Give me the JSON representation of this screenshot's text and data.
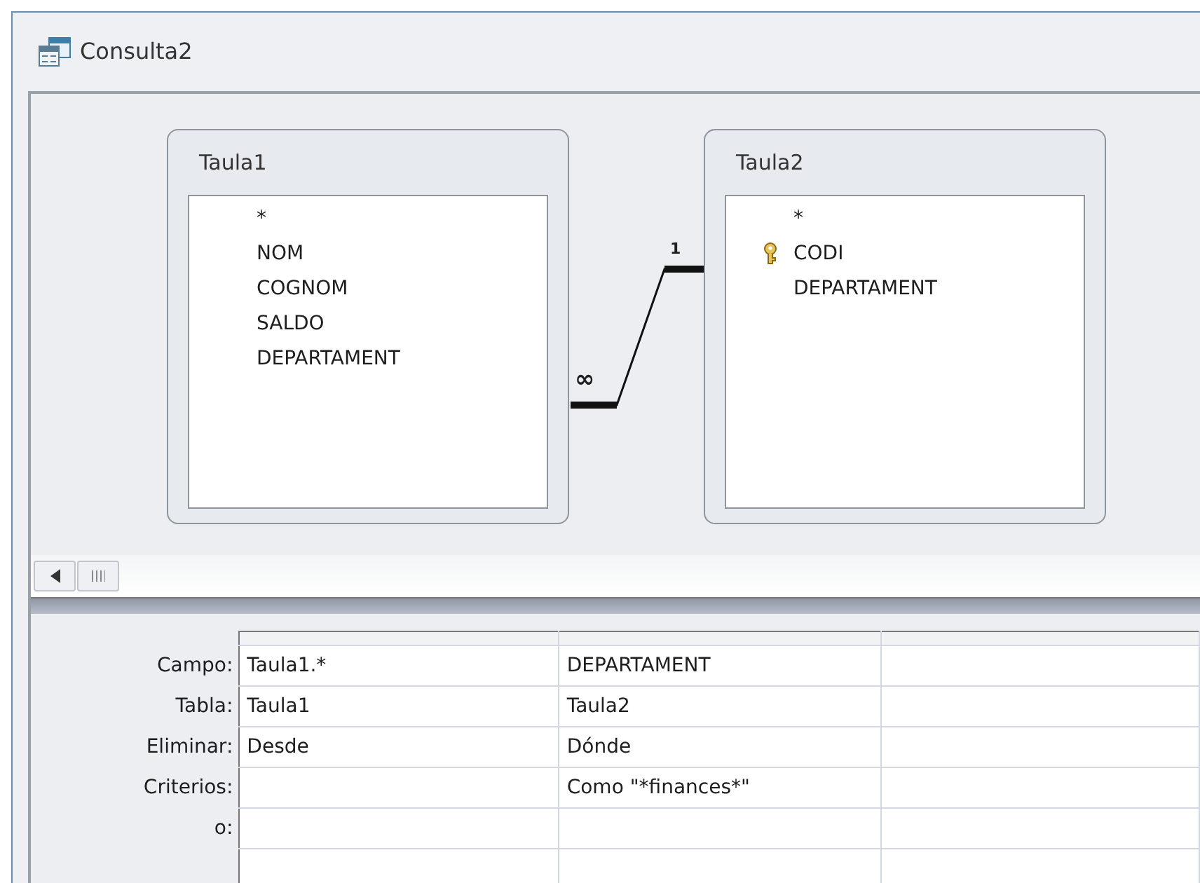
{
  "window": {
    "title": "Consulta2"
  },
  "tables": [
    {
      "name": "Taula1",
      "fields": [
        {
          "name": "*",
          "primary_key": false
        },
        {
          "name": "NOM",
          "primary_key": false
        },
        {
          "name": "COGNOM",
          "primary_key": false
        },
        {
          "name": "SALDO",
          "primary_key": false
        },
        {
          "name": "DEPARTAMENT",
          "primary_key": false
        }
      ]
    },
    {
      "name": "Taula2",
      "fields": [
        {
          "name": "*",
          "primary_key": false
        },
        {
          "name": "CODI",
          "primary_key": true
        },
        {
          "name": "DEPARTAMENT",
          "primary_key": false
        }
      ]
    }
  ],
  "relationship": {
    "many_label": "∞",
    "one_label": "1"
  },
  "grid": {
    "rows": [
      {
        "kind": "field",
        "label": "Campo:"
      },
      {
        "kind": "table",
        "label": "Tabla:"
      },
      {
        "kind": "delete",
        "label": "Eliminar:"
      },
      {
        "kind": "criteria",
        "label": "Criterios:"
      },
      {
        "kind": "or",
        "label": "o:"
      }
    ],
    "columns": [
      {
        "field": "Taula1.*",
        "table": "Taula1",
        "delete": "Desde"
      },
      {
        "field": "DEPARTAMENT",
        "table": "Taula2",
        "delete": "Dónde",
        "criteria": "Como \"*finances*\""
      }
    ]
  }
}
